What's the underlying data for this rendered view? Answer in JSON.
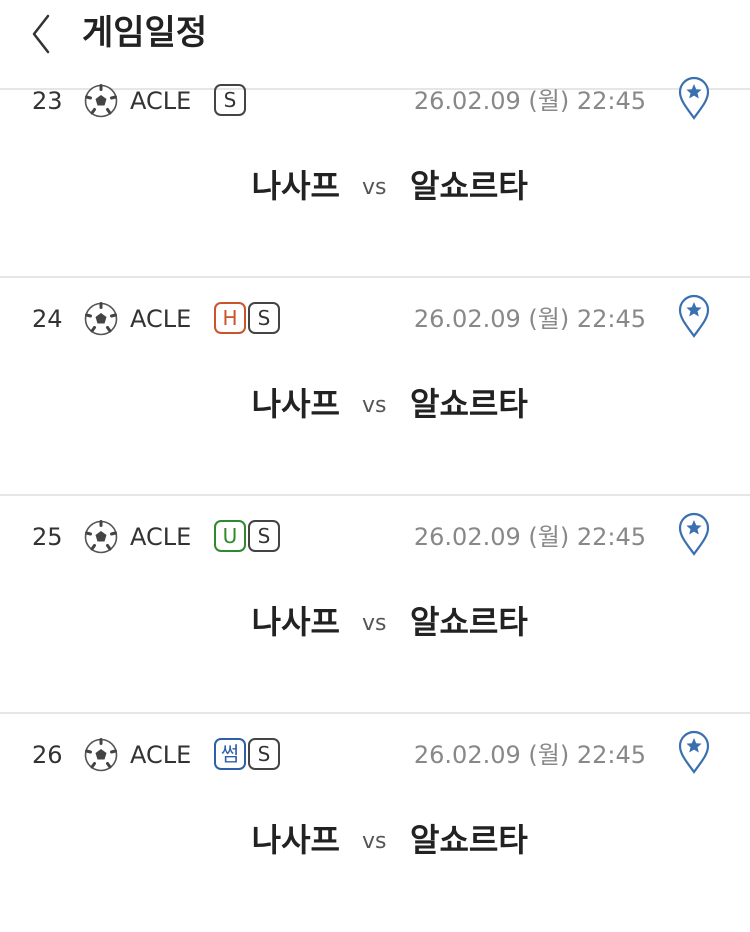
{
  "header": {
    "title": "게임일정",
    "back_icon": "chevron-left-icon"
  },
  "colors": {
    "badge_H": "#c9552a",
    "badge_U": "#2f8a2f",
    "badge_sum": "#2f5fa8",
    "pin": "#3a6fb0"
  },
  "games": [
    {
      "num": "23",
      "league": "ACLE",
      "badges": [
        "S"
      ],
      "datetime": "26.02.09 (월) 22:45",
      "home": "나사프",
      "vs": "vs",
      "away": "알쇼르타"
    },
    {
      "num": "24",
      "league": "ACLE",
      "badges": [
        "H",
        "S"
      ],
      "datetime": "26.02.09 (월) 22:45",
      "home": "나사프",
      "vs": "vs",
      "away": "알쇼르타"
    },
    {
      "num": "25",
      "league": "ACLE",
      "badges": [
        "U",
        "S"
      ],
      "datetime": "26.02.09 (월) 22:45",
      "home": "나사프",
      "vs": "vs",
      "away": "알쇼르타"
    },
    {
      "num": "26",
      "league": "ACLE",
      "badges": [
        "썸",
        "S"
      ],
      "datetime": "26.02.09 (월) 22:45",
      "home": "나사프",
      "vs": "vs",
      "away": "알쇼르타"
    }
  ]
}
